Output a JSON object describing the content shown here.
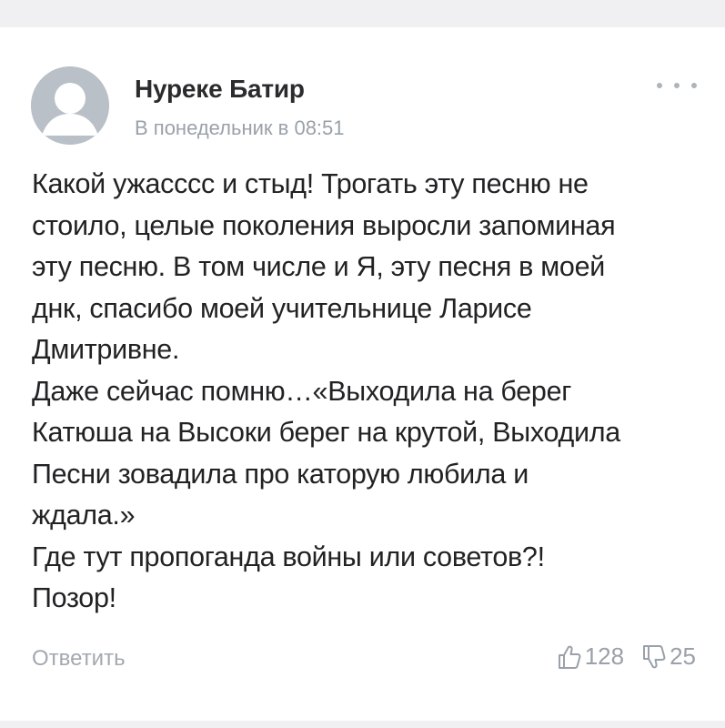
{
  "post": {
    "author": "Нуреке Батир",
    "timestamp": "В понедельник в 08:51",
    "comment_lines": [
      "Какой ужасссс и стыд! Трогать эту песню не",
      "стоило, целые поколения выросли запоминая",
      "эту песню. В том числе и Я, эту песня в моей",
      "днк, спасибо моей учительнице Ларисе",
      "Дмитривне.",
      "Даже сейчас помню…«Выходила на берег",
      "Катюша на Высоки берег на крутой, Выходила",
      "Песни зовадила про каторую любила и",
      "ждала.»",
      "Где тут пропоганда войны или советов?!",
      "Позор!"
    ]
  },
  "actions": {
    "reply_label": "Ответить",
    "like_count": "128",
    "dislike_count": "25"
  },
  "icons": {
    "avatar": "default-user-avatar",
    "more": "more-horizontal-icon",
    "like": "thumbs-up-icon",
    "dislike": "thumbs-down-icon"
  },
  "colors": {
    "avatar_bg": "#b9c0c8",
    "muted_text": "#9aa1a9",
    "body_text": "#222224"
  }
}
